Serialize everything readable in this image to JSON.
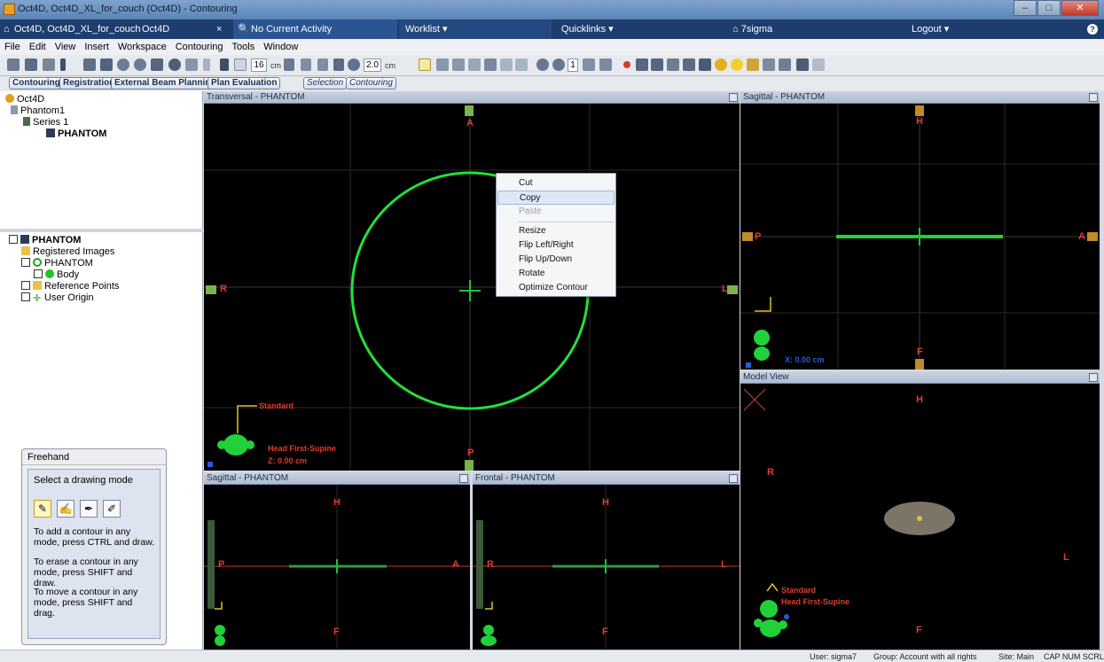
{
  "window": {
    "title": "Oct4D, Oct4D_XL_for_couch (Oct4D) - Contouring"
  },
  "nav": {
    "home": "Oct4D, Oct4D_XL_for_couch",
    "tab": "Oct4D",
    "activity": "No Current Activity",
    "worklist": "Worklist",
    "quicklinks": "Quicklinks",
    "user_home": "7sigma",
    "logout": "Logout"
  },
  "menu": [
    "File",
    "Edit",
    "View",
    "Insert",
    "Workspace",
    "Contouring",
    "Tools",
    "Window"
  ],
  "toolbar": {
    "slice_value": "16",
    "slice_unit": "cm",
    "zoom_value": "2.0",
    "zoom_unit": "cm",
    "count_value": "1"
  },
  "workspace_tabs": [
    "Contouring",
    "Registration",
    "External Beam Planning",
    "Plan Evaluation"
  ],
  "mode_tabs": [
    "Selection",
    "Contouring"
  ],
  "patient_tree": {
    "root": "Oct4D",
    "patient": "Phantom1",
    "series": "Series 1",
    "image": "PHANTOM"
  },
  "structure_tree": {
    "image": "PHANTOM",
    "registered": "Registered Images",
    "set": "PHANTOM",
    "body": "Body",
    "refpoints": "Reference Points",
    "origin": "User Origin"
  },
  "freehand": {
    "title": "Freehand",
    "prompt": "Select a drawing mode",
    "help1": "To add a contour in any mode, press CTRL and draw.",
    "help2": "To erase a contour in any mode, press SHIFT and draw.",
    "help3": "To move a contour in any mode, press SHIFT and drag."
  },
  "views": {
    "transversal": {
      "title": "Transversal - PHANTOM",
      "A": "A",
      "P": "P",
      "R": "R",
      "L": "L",
      "standard": "Standard",
      "orientation": "Head First-Supine",
      "zcoord": "Z: 0.00 cm"
    },
    "sagittal_top": {
      "title": "Sagittal - PHANTOM",
      "H": "H",
      "F": "F",
      "P": "P",
      "A": "A",
      "xcoord": "X: 0.00 cm"
    },
    "model": {
      "title": "Model View",
      "H": "H",
      "R": "R",
      "L": "L",
      "F": "F",
      "standard": "Standard",
      "orientation": "Head First-Supine"
    },
    "sagittal_bottom": {
      "title": "Sagittal - PHANTOM",
      "H": "H",
      "F": "F",
      "P": "P",
      "A": "A"
    },
    "frontal": {
      "title": "Frontal - PHANTOM",
      "H": "H",
      "F": "F",
      "R": "R",
      "L": "L"
    }
  },
  "context_menu": {
    "cut": "Cut",
    "copy": "Copy",
    "paste": "Paste",
    "resize": "Resize",
    "flip_lr": "Flip Left/Right",
    "flip_ud": "Flip Up/Down",
    "rotate": "Rotate",
    "optimize": "Optimize Contour"
  },
  "status": {
    "user": "User: sigma7",
    "group": "Group: Account with all rights",
    "site": "Site: Main",
    "keys": "CAP NUM SCRL"
  },
  "colors": {
    "contour": "#22e03a",
    "orient_label": "#e23b2e",
    "nav_bg": "#1c3d6e"
  }
}
